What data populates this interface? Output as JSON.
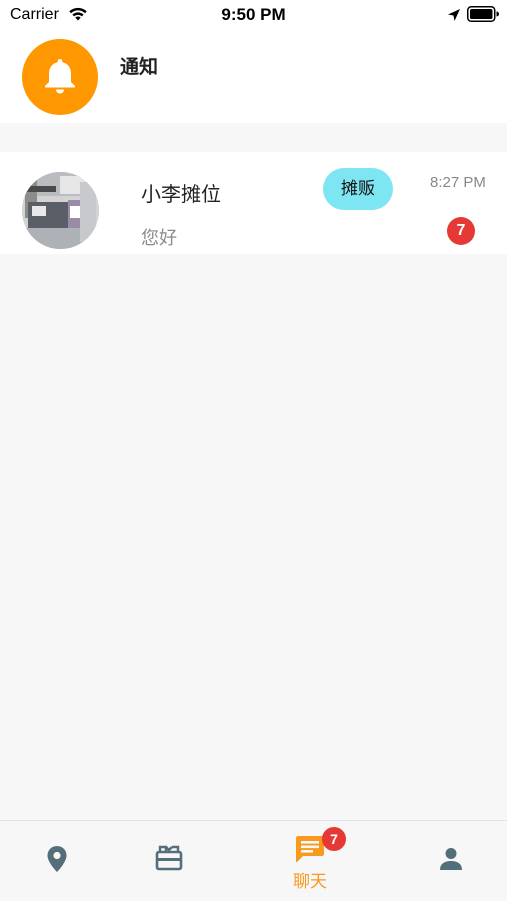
{
  "status_bar": {
    "carrier": "Carrier",
    "time": "9:50 PM",
    "icons": [
      "wifi-icon",
      "location-arrow-icon",
      "battery-icon"
    ]
  },
  "notice": {
    "title": "通知",
    "icon": "bell-icon",
    "icon_bg": "#ff9800"
  },
  "chats": [
    {
      "name": "小李摊位",
      "tag": "摊贩",
      "time": "8:27 PM",
      "message": "您好",
      "unread": "7",
      "tag_color": "#7ee6f3"
    }
  ],
  "tab_bar": {
    "tabs": [
      {
        "icon": "map-pin-icon",
        "label": "",
        "active": false
      },
      {
        "icon": "store-icon",
        "label": "",
        "active": false
      },
      {
        "icon": "chat-icon",
        "label": "聊天",
        "active": true,
        "badge": "7"
      },
      {
        "icon": "person-icon",
        "label": "",
        "active": false
      }
    ],
    "active_color": "#f79a1d",
    "inactive_color": "#546e7a"
  }
}
